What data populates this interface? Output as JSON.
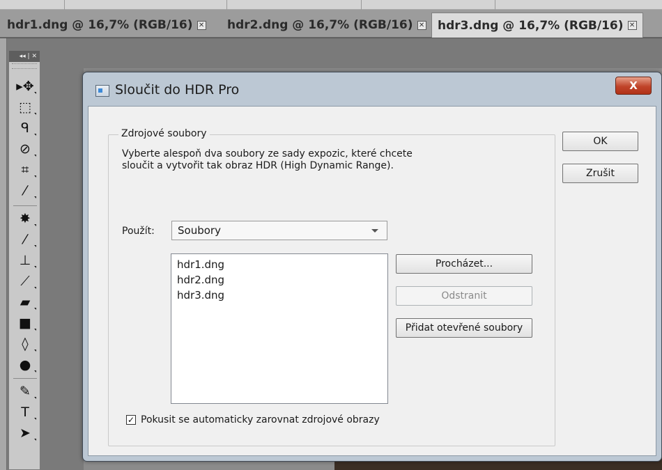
{
  "document_tabs": [
    {
      "label": "hdr1.dng @ 16,7% (RGB/16)",
      "close_glyph": "✕",
      "active": false
    },
    {
      "label": "hdr2.dng @ 16,7% (RGB/16)",
      "close_glyph": "✕",
      "active": false
    },
    {
      "label": "hdr3.dng @ 16,7% (RGB/16)",
      "close_glyph": "✕",
      "active": true
    }
  ],
  "tools_panel": {
    "header": "◂◂ | ✕",
    "tools": [
      {
        "name": "move-tool-icon",
        "glyph": "▸✥"
      },
      {
        "name": "marquee-tool-icon",
        "glyph": "⬚"
      },
      {
        "name": "lasso-tool-icon",
        "glyph": "ᑫ"
      },
      {
        "name": "quick-selection-tool-icon",
        "glyph": "⊘"
      },
      {
        "name": "crop-tool-icon",
        "glyph": "⌗"
      },
      {
        "name": "eyedropper-tool-icon",
        "glyph": "⁄"
      },
      {
        "name": "spot-healing-tool-icon",
        "glyph": "✸"
      },
      {
        "name": "brush-tool-icon",
        "glyph": "⁄"
      },
      {
        "name": "clone-stamp-tool-icon",
        "glyph": "⊥"
      },
      {
        "name": "history-brush-tool-icon",
        "glyph": "⟋"
      },
      {
        "name": "eraser-tool-icon",
        "glyph": "▰"
      },
      {
        "name": "gradient-tool-icon",
        "glyph": "■"
      },
      {
        "name": "blur-tool-icon",
        "glyph": "◊"
      },
      {
        "name": "dodge-tool-icon",
        "glyph": "●"
      },
      {
        "name": "pen-tool-icon",
        "glyph": "✎"
      },
      {
        "name": "type-tool-icon",
        "glyph": "T"
      },
      {
        "name": "path-selection-tool-icon",
        "glyph": "➤"
      }
    ]
  },
  "dialog": {
    "title": "Sloučit do HDR Pro",
    "close_label": "X",
    "group_title": "Zdrojové soubory",
    "description": "Vyberte alespoň dva soubory ze sady expozic, které chcete sloučit a vytvořit tak obraz HDR (High Dynamic Range).",
    "use_label": "Použít:",
    "use_value": "Soubory",
    "files": [
      "hdr1.dng",
      "hdr2.dng",
      "hdr3.dng"
    ],
    "buttons": {
      "ok": "OK",
      "cancel": "Zrušit",
      "browse": "Procházet...",
      "remove": "Odstranit",
      "add_open": "Přidat otevřené soubory"
    },
    "auto_align": {
      "label": "Pokusit se automaticky zarovnat zdrojové obrazy",
      "checked": true,
      "check_glyph": "✓"
    }
  }
}
